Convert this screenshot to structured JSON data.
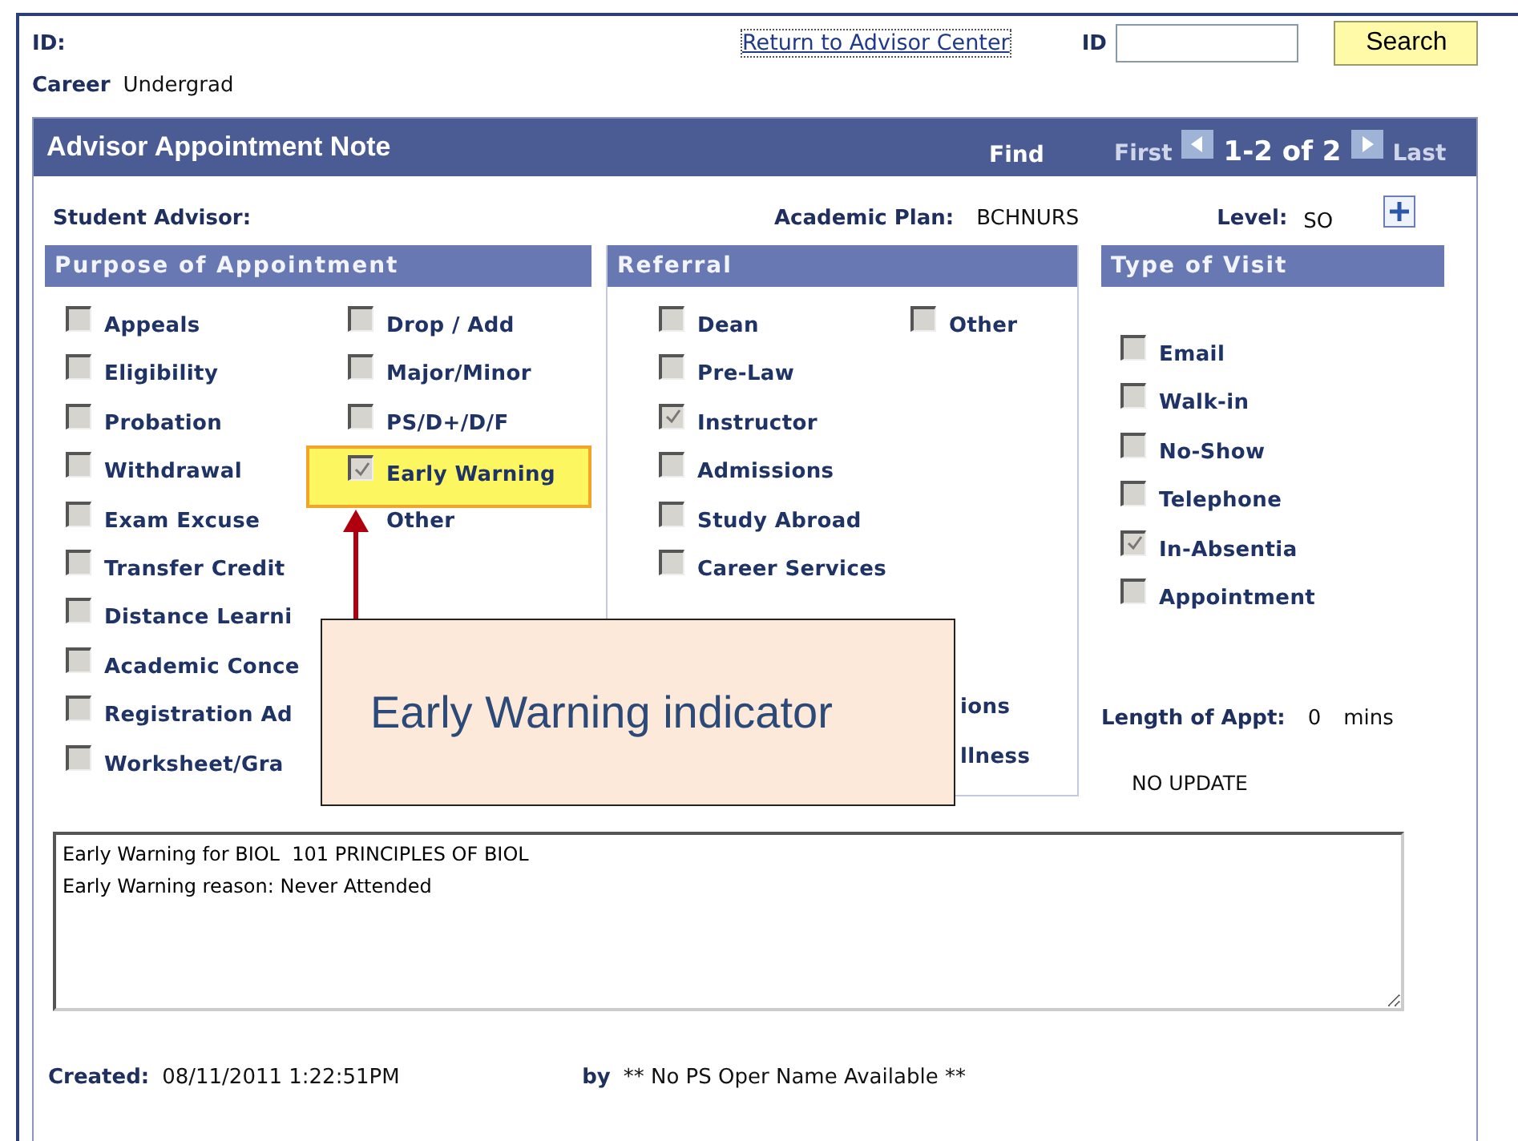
{
  "header": {
    "id_label": "ID:",
    "career_label": "Career",
    "career_value": "Undergrad",
    "return_link": "Return to Advisor Center",
    "id_field_label": "ID",
    "search_button": "Search"
  },
  "panel": {
    "title": "Advisor Appointment Note",
    "find": "Find",
    "first": "First",
    "range": "1-2 of 2",
    "last": "Last"
  },
  "info": {
    "student_advisor_label": "Student Advisor:",
    "academic_plan_label": "Academic Plan:",
    "academic_plan": "BCHNURS",
    "level_label": "Level:",
    "level": "SO"
  },
  "purpose": {
    "title": "Purpose of Appointment",
    "columns": [
      [
        {
          "label": "Appeals",
          "checked": false,
          "highlighted": false
        },
        {
          "label": "Eligibility",
          "checked": false,
          "highlighted": false
        },
        {
          "label": "Probation",
          "checked": false,
          "highlighted": false
        },
        {
          "label": "Withdrawal",
          "checked": false,
          "highlighted": false
        },
        {
          "label": "Exam Excuse",
          "checked": false,
          "highlighted": false
        },
        {
          "label": "Transfer Credit",
          "checked": false,
          "highlighted": false
        },
        {
          "label": "Distance Learni",
          "checked": false,
          "highlighted": false
        },
        {
          "label": "Academic Conce",
          "checked": false,
          "highlighted": false
        },
        {
          "label": "Registration Ad",
          "checked": false,
          "highlighted": false
        },
        {
          "label": "Worksheet/Gra",
          "checked": false,
          "highlighted": false
        }
      ],
      [
        {
          "label": "Drop / Add",
          "checked": false,
          "highlighted": false
        },
        {
          "label": "Major/Minor",
          "checked": false,
          "highlighted": false
        },
        {
          "label": "PS/D+/D/F",
          "checked": false,
          "highlighted": false
        },
        {
          "label": "Early Warning",
          "checked": true,
          "highlighted": true
        },
        {
          "label": "Other",
          "highlighted": false
        }
      ]
    ]
  },
  "referral": {
    "title": "Referral",
    "columns": [
      [
        {
          "label": "Dean",
          "checked": false
        },
        {
          "label": "Pre-Law",
          "checked": false
        },
        {
          "label": "Instructor",
          "checked": true
        },
        {
          "label": "Admissions",
          "checked": false
        },
        {
          "label": "Study Abroad",
          "checked": false
        },
        {
          "label": "Career Services",
          "checked": false
        }
      ],
      [
        {
          "label": "Other",
          "checked": false
        }
      ]
    ],
    "partial_labels": [
      "ions",
      "llness"
    ]
  },
  "visit": {
    "title": "Type of Visit",
    "items": [
      {
        "label": "Email",
        "checked": false
      },
      {
        "label": "Walk-in",
        "checked": false
      },
      {
        "label": "No-Show",
        "checked": false
      },
      {
        "label": "Telephone",
        "checked": false
      },
      {
        "label": "In-Absentia",
        "checked": true
      },
      {
        "label": "Appointment",
        "checked": false
      }
    ],
    "length_label": "Length of Appt:",
    "length_value": "0",
    "length_unit": "mins",
    "status": "NO UPDATE"
  },
  "note": {
    "value": "Early Warning for BIOL  101 PRINCIPLES OF BIOL\nEarly Warning reason: Never Attended"
  },
  "footer": {
    "created_label": "Created:",
    "created_value": "08/11/2011  1:22:51PM",
    "by_label": "by",
    "by_value": "** No PS Oper Name Available **"
  },
  "callout": {
    "text": "Early Warning indicator"
  }
}
